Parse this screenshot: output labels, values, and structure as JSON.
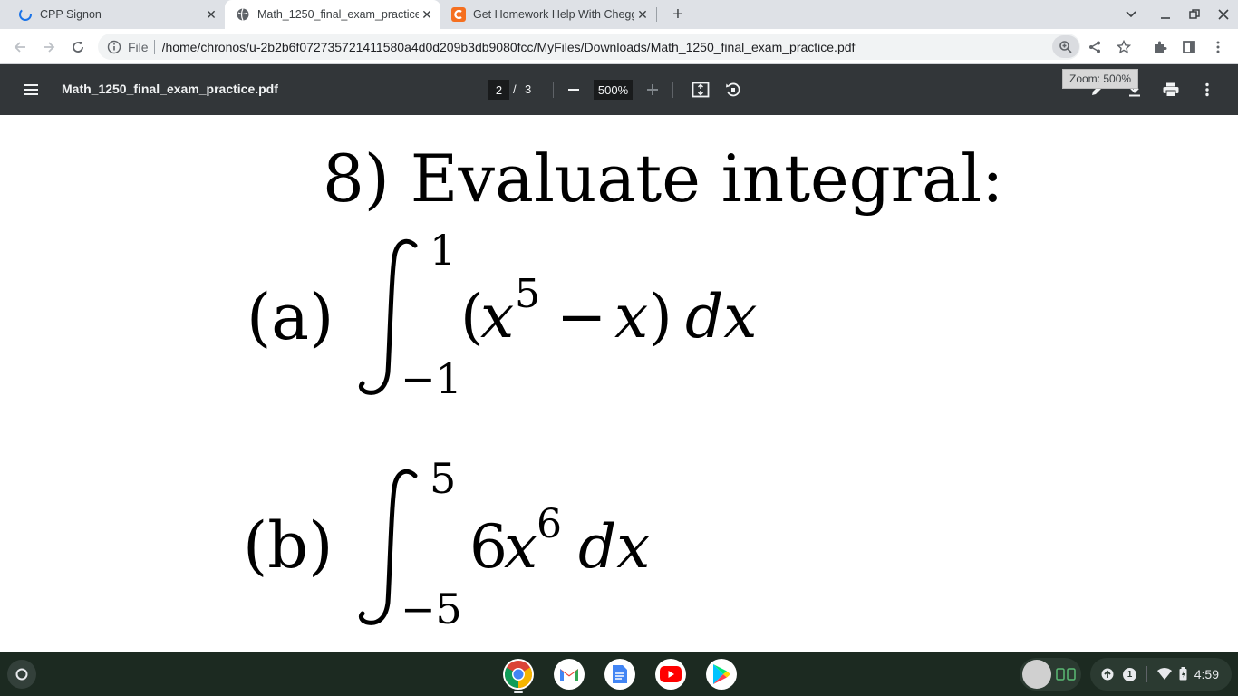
{
  "tabs": [
    {
      "title": "CPP Signon",
      "active": false
    },
    {
      "title": "Math_1250_final_exam_practice",
      "active": true
    },
    {
      "title": "Get Homework Help With Chegg",
      "active": false
    }
  ],
  "toolbar": {
    "scheme_label": "File",
    "url": "/home/chronos/u-2b2b6f072735721411580a4d0d209b3db9080fcc/MyFiles/Downloads/Math_1250_final_exam_practice.pdf"
  },
  "pdf": {
    "filename": "Math_1250_final_exam_practice.pdf",
    "current_page": "2",
    "page_sep": "/",
    "total_pages": "3",
    "zoom": "500%",
    "zoom_tooltip": "Zoom: 500%"
  },
  "document": {
    "heading": "8) Evaluate integral:",
    "part_a": {
      "label": "(a)",
      "upper": "1",
      "lower": "−1",
      "open_paren": "(",
      "var1": "x",
      "exp1": "5",
      "minus": "−",
      "var2": "x",
      "close_paren": ")",
      "dx": "dx"
    },
    "part_b": {
      "label": "(b)",
      "upper": "5",
      "lower": "−5",
      "coef": "6",
      "var": "x",
      "exp": "6",
      "dx": "dx"
    }
  },
  "shelf": {
    "apps": [
      "chrome-icon",
      "gmail-icon",
      "docs-icon",
      "youtube-icon",
      "play-store-icon"
    ],
    "notification_count": "1",
    "time": "4:59"
  },
  "colors": {
    "tab_strip": "#dee1e6",
    "pdf_toolbar": "#323639",
    "shelf": "#1c2a21",
    "chegg_orange": "#f56f1f"
  }
}
